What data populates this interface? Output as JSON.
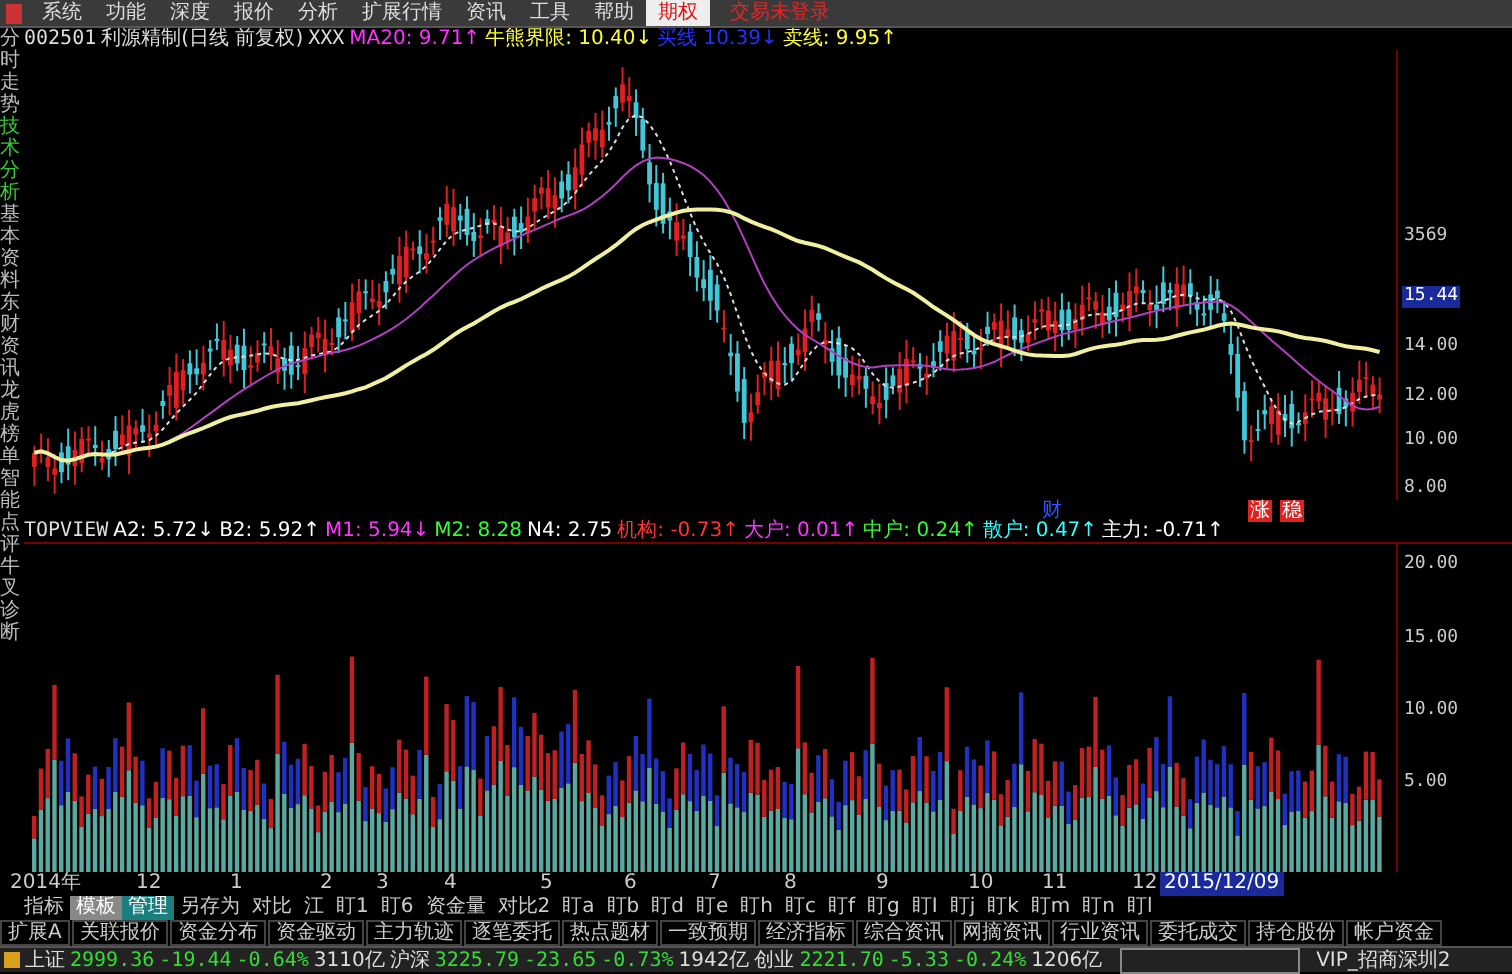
{
  "menu": [
    {
      "label": "系统",
      "selected": false
    },
    {
      "label": "功能",
      "selected": false
    },
    {
      "label": "深度",
      "selected": false
    },
    {
      "label": "报价",
      "selected": false
    },
    {
      "label": "分析",
      "selected": false
    },
    {
      "label": "扩展行情",
      "selected": false
    },
    {
      "label": "资讯",
      "selected": false
    },
    {
      "label": "工具",
      "selected": false
    },
    {
      "label": "帮助",
      "selected": false
    },
    {
      "label": "期权",
      "selected": true
    }
  ],
  "login_status": "交易未登录",
  "header": {
    "code": "002501",
    "title": "利源精制(日线 前复权)",
    "tag": "XXX",
    "indicators": [
      {
        "label": "MA20:",
        "value": "9.71↑",
        "color": "#ff33ff"
      },
      {
        "label": "牛熊界限:",
        "value": "10.40↓",
        "color": "#ffff33"
      },
      {
        "label": "买线",
        "value": "10.39↓",
        "color": "#2233ff"
      },
      {
        "label": "卖线:",
        "value": "9.95↑",
        "color": "#ffff33"
      }
    ]
  },
  "sidebar": [
    {
      "label": "分时走势",
      "selected": false
    },
    {
      "label": "技术分析",
      "selected": true
    },
    {
      "label": "基本资料",
      "selected": false
    },
    {
      "label": "东财资讯",
      "selected": false
    },
    {
      "label": "龙虎榜单",
      "selected": false
    },
    {
      "label": "智能点评",
      "selected": false
    },
    {
      "label": "牛叉诊断",
      "selected": false
    }
  ],
  "price_axis": [
    {
      "label": "3569",
      "highlighted": false
    },
    {
      "label": "15.44",
      "highlighted": true
    },
    {
      "label": "14.00",
      "highlighted": false
    },
    {
      "label": "12.00",
      "highlighted": false
    },
    {
      "label": "10.00",
      "highlighted": false
    },
    {
      "label": "8.00",
      "highlighted": false
    }
  ],
  "event_markers": [
    {
      "label": "财",
      "color": "#3355ff"
    },
    {
      "label": "涨",
      "color": "#dd2222"
    },
    {
      "label": "稳",
      "color": "#dd2222"
    }
  ],
  "indicator_line": {
    "name": "TOPVIEW",
    "items": [
      {
        "label": "A2:",
        "value": "5.72↓",
        "color": "#ffffff"
      },
      {
        "label": "B2:",
        "value": "5.92↑",
        "color": "#ffffff"
      },
      {
        "label": "M1:",
        "value": "5.94↓",
        "color": "#ff33ff"
      },
      {
        "label": "M2:",
        "value": "8.28",
        "color": "#33ff33"
      },
      {
        "label": "N4:",
        "value": "2.75",
        "color": "#ffffff"
      },
      {
        "label": "机构:",
        "value": "-0.73↑",
        "color": "#ff3333"
      },
      {
        "label": "大户:",
        "value": "0.01↑",
        "color": "#ff33ff"
      },
      {
        "label": "中户:",
        "value": "0.24↑",
        "color": "#33ff33"
      },
      {
        "label": "散户:",
        "value": "0.47↑",
        "color": "#33ffff"
      },
      {
        "label": "主力:",
        "value": "-0.71↑",
        "color": "#ffffff"
      }
    ]
  },
  "volume_axis": [
    "20.00",
    "15.00",
    "10.00",
    "5.00"
  ],
  "date_axis": [
    {
      "label": "2014年",
      "highlighted": false
    },
    {
      "label": "12",
      "highlighted": false
    },
    {
      "label": "1",
      "highlighted": false
    },
    {
      "label": "2",
      "highlighted": false
    },
    {
      "label": "3",
      "highlighted": false
    },
    {
      "label": "4",
      "highlighted": false
    },
    {
      "label": "5",
      "highlighted": false
    },
    {
      "label": "6",
      "highlighted": false
    },
    {
      "label": "7",
      "highlighted": false
    },
    {
      "label": "8",
      "highlighted": false
    },
    {
      "label": "9",
      "highlighted": false
    },
    {
      "label": "10",
      "highlighted": false
    },
    {
      "label": "11",
      "highlighted": false
    },
    {
      "label": "12",
      "highlighted": false
    },
    {
      "label": "2015/12/09",
      "highlighted": true
    }
  ],
  "indicator_tabs": [
    {
      "label": "指标",
      "selected": false,
      "kind": "tab"
    },
    {
      "label": "模板",
      "selected": true,
      "kind": "tab"
    },
    {
      "label": "管理",
      "selected": false,
      "kind": "action"
    },
    {
      "label": "另存为",
      "selected": false,
      "kind": "tab"
    },
    {
      "label": "对比",
      "selected": false,
      "kind": "tab"
    },
    {
      "label": "江",
      "selected": false,
      "kind": "tab"
    },
    {
      "label": "盯1",
      "selected": false,
      "kind": "tab"
    },
    {
      "label": "盯6",
      "selected": false,
      "kind": "tab"
    },
    {
      "label": "资金量",
      "selected": false,
      "kind": "tab"
    },
    {
      "label": "对比2",
      "selected": false,
      "kind": "tab"
    },
    {
      "label": "盯a",
      "selected": false,
      "kind": "tab"
    },
    {
      "label": "盯b",
      "selected": false,
      "kind": "tab"
    },
    {
      "label": "盯d",
      "selected": false,
      "kind": "tab"
    },
    {
      "label": "盯e",
      "selected": false,
      "kind": "tab"
    },
    {
      "label": "盯h",
      "selected": false,
      "kind": "tab"
    },
    {
      "label": "盯c",
      "selected": false,
      "kind": "tab"
    },
    {
      "label": "盯f",
      "selected": false,
      "kind": "tab"
    },
    {
      "label": "盯g",
      "selected": false,
      "kind": "tab"
    },
    {
      "label": "盯I",
      "selected": false,
      "kind": "tab"
    },
    {
      "label": "盯j",
      "selected": false,
      "kind": "tab"
    },
    {
      "label": "盯k",
      "selected": false,
      "kind": "tab"
    },
    {
      "label": "盯m",
      "selected": false,
      "kind": "tab"
    },
    {
      "label": "盯n",
      "selected": false,
      "kind": "tab"
    },
    {
      "label": "盯l",
      "selected": false,
      "kind": "tab"
    }
  ],
  "extension_tabs": [
    "扩展A",
    "关联报价",
    "资金分布",
    "资金驱动",
    "主力轨迹",
    "逐笔委托",
    "热点题材",
    "一致预期",
    "经济指标",
    "综合资讯",
    "网摘资讯",
    "行业资讯",
    "委托成交",
    "持仓股份",
    "帐户资金"
  ],
  "status_bar": {
    "indices": [
      {
        "name": "上证",
        "value": "2999.36",
        "change": "-19.44",
        "percent": "-0.64%",
        "amount": "3110亿"
      },
      {
        "name": "沪深",
        "value": "3225.79",
        "change": "-23.65",
        "percent": "-0.73%",
        "amount": "1942亿"
      },
      {
        "name": "创业",
        "value": "2221.70",
        "change": "-5.33",
        "percent": "-0.24%",
        "amount": "1206亿"
      }
    ],
    "server": "VIP_招商深圳2"
  }
}
